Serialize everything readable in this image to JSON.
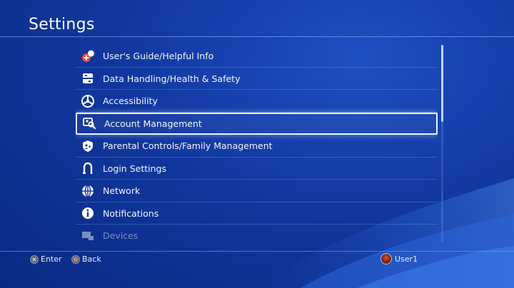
{
  "header": {
    "title": "Settings"
  },
  "menu": {
    "items": [
      {
        "label": "User's Guide/Helpful Info",
        "icon": "guide-icon"
      },
      {
        "label": "Data Handling/Health & Safety",
        "icon": "data-health-icon"
      },
      {
        "label": "Accessibility",
        "icon": "accessibility-icon"
      },
      {
        "label": "Account Management",
        "icon": "account-management-icon",
        "selected": true
      },
      {
        "label": "Parental Controls/Family Management",
        "icon": "parental-controls-icon"
      },
      {
        "label": "Login Settings",
        "icon": "login-icon"
      },
      {
        "label": "Network",
        "icon": "network-icon"
      },
      {
        "label": "Notifications",
        "icon": "notifications-icon"
      },
      {
        "label": "Devices",
        "icon": "devices-icon"
      }
    ]
  },
  "footer": {
    "enter_label": "Enter",
    "back_label": "Back",
    "user_name": "User1"
  },
  "colors": {
    "background": "#1138a0",
    "accent_line": "#96b9ff",
    "selection_border": "#eaf1ff",
    "guide_icon_red": "#e8453c"
  }
}
